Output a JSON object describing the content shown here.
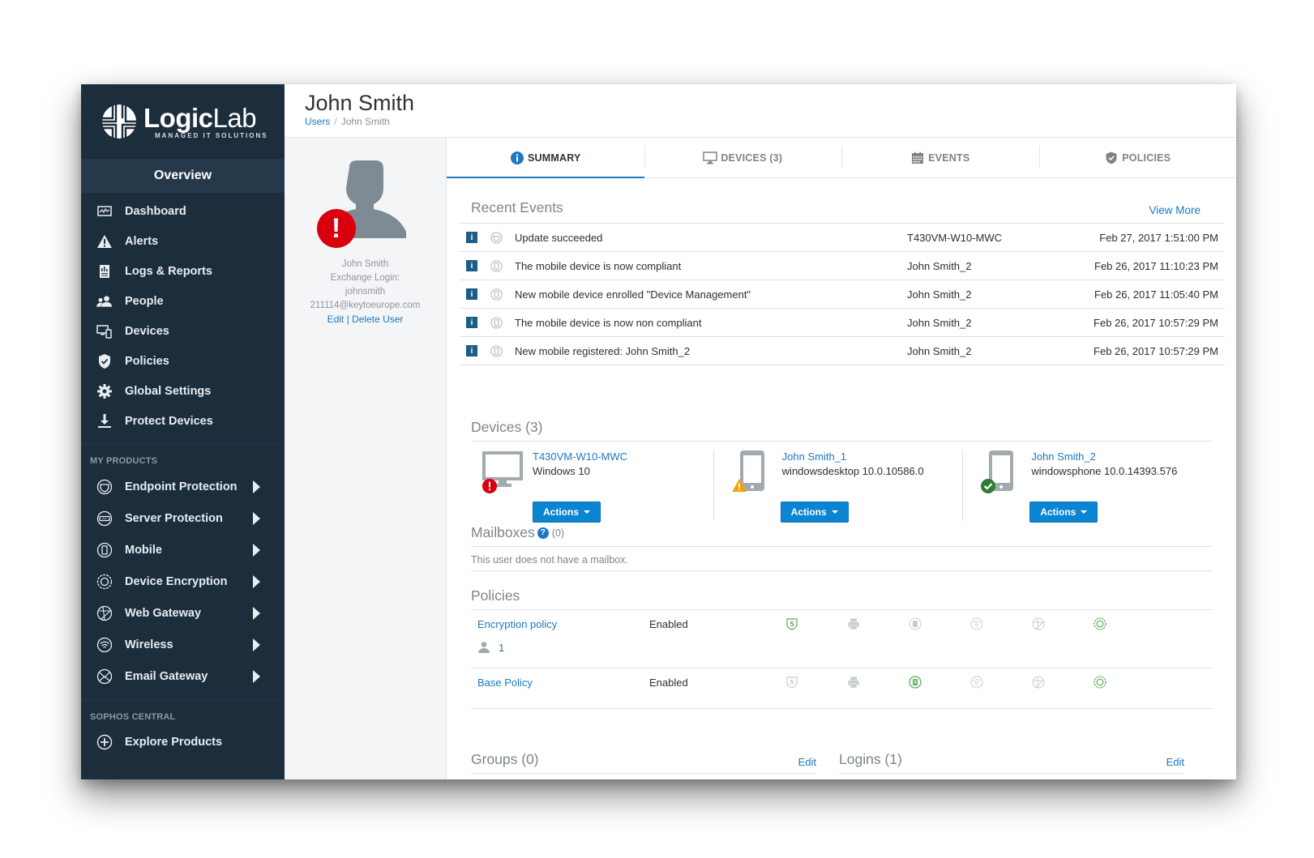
{
  "brand": {
    "name_bold": "Logic",
    "name_light": "Lab",
    "tagline": "MANAGED IT SOLUTIONS"
  },
  "sidebar": {
    "overview_label": "Overview",
    "nav": [
      {
        "label": "Dashboard",
        "icon": "dashboard-icon"
      },
      {
        "label": "Alerts",
        "icon": "alert-icon"
      },
      {
        "label": "Logs & Reports",
        "icon": "report-icon"
      },
      {
        "label": "People",
        "icon": "people-icon"
      },
      {
        "label": "Devices",
        "icon": "devices-icon"
      },
      {
        "label": "Policies",
        "icon": "shield-check-icon"
      },
      {
        "label": "Global Settings",
        "icon": "gear-icon"
      },
      {
        "label": "Protect Devices",
        "icon": "download-icon"
      }
    ],
    "products_title": "MY PRODUCTS",
    "products": [
      {
        "label": "Endpoint Protection",
        "icon": "endpoint-icon"
      },
      {
        "label": "Server Protection",
        "icon": "server-icon"
      },
      {
        "label": "Mobile",
        "icon": "mobile-icon"
      },
      {
        "label": "Device Encryption",
        "icon": "encryption-icon"
      },
      {
        "label": "Web Gateway",
        "icon": "web-icon"
      },
      {
        "label": "Wireless",
        "icon": "wireless-icon"
      },
      {
        "label": "Email Gateway",
        "icon": "email-icon"
      }
    ],
    "central_title": "SOPHOS CENTRAL",
    "central": [
      {
        "label": "Explore Products",
        "icon": "plus-circle-icon"
      }
    ]
  },
  "header": {
    "title": "John Smith",
    "breadcrumb": [
      {
        "label": "Users",
        "link": true
      },
      {
        "label": "John Smith",
        "link": false
      }
    ]
  },
  "profile": {
    "name": "John Smith",
    "exchange_label": "Exchange Login:",
    "exchange_login": "johnsmith",
    "email": "211114@keytoeurope.com",
    "edit_label": "Edit",
    "link_sep": "|",
    "delete_label": "Delete User"
  },
  "tabs": [
    {
      "label": "SUMMARY",
      "icon": "info-icon",
      "active": true
    },
    {
      "label": "DEVICES (3)",
      "icon": "monitor-icon",
      "active": false
    },
    {
      "label": "EVENTS",
      "icon": "calendar-icon",
      "active": false
    },
    {
      "label": "POLICIES",
      "icon": "shield-icon",
      "active": false
    }
  ],
  "recent_events": {
    "title": "Recent Events",
    "view_more": "View More",
    "rows": [
      {
        "type_icon": "endpoint-icon",
        "message": "Update succeeded",
        "device": "T430VM-W10-MWC",
        "time": "Feb 27, 2017 1:51:00 PM"
      },
      {
        "type_icon": "mobile-icon",
        "message": "The mobile device is now compliant",
        "device": "John Smith_2",
        "time": "Feb 26, 2017 11:10:23 PM"
      },
      {
        "type_icon": "mobile-icon",
        "message": "New mobile device enrolled \"Device Management\"",
        "device": "John Smith_2",
        "time": "Feb 26, 2017 11:05:40 PM"
      },
      {
        "type_icon": "mobile-icon",
        "message": "The mobile device is now non compliant",
        "device": "John Smith_2",
        "time": "Feb 26, 2017 10:57:29 PM"
      },
      {
        "type_icon": "mobile-icon",
        "message": "New mobile registered: John Smith_2",
        "device": "John Smith_2",
        "time": "Feb 26, 2017 10:57:29 PM"
      }
    ]
  },
  "devices": {
    "title": "Devices (3)",
    "items": [
      {
        "name": "T430VM-W10-MWC",
        "os": "Windows 10",
        "kind": "desktop",
        "status": "error",
        "actions_label": "Actions"
      },
      {
        "name": "John Smith_1",
        "os": "windowsdesktop 10.0.10586.0",
        "kind": "mobile",
        "status": "warning",
        "actions_label": "Actions"
      },
      {
        "name": "John Smith_2",
        "os": "windowsphone 10.0.14393.576",
        "kind": "mobile",
        "status": "ok",
        "actions_label": "Actions"
      }
    ]
  },
  "mailboxes": {
    "title": "Mailboxes",
    "help": "?",
    "count": "(0)",
    "note": "This user does not have a mailbox."
  },
  "policies": {
    "title": "Policies",
    "product_icons": [
      "encryption-shield-icon",
      "printer-icon",
      "mobile-icon",
      "wireless-icon",
      "web-icon",
      "endpoint-gear-icon"
    ],
    "rows": [
      {
        "name": "Encryption policy",
        "status": "Enabled",
        "users": "1",
        "icon_states": [
          true,
          false,
          false,
          false,
          false,
          true
        ]
      },
      {
        "name": "Base Policy",
        "status": "Enabled",
        "users": null,
        "icon_states": [
          false,
          false,
          true,
          false,
          false,
          true
        ]
      }
    ]
  },
  "groups": {
    "title": "Groups (0)",
    "edit_label": "Edit"
  },
  "logins": {
    "title": "Logins (1)",
    "edit_label": "Edit"
  },
  "colors": {
    "sidebar_bg": "#1c2d3c",
    "accent_blue": "#1b78c4",
    "button_blue": "#0b85d1",
    "error_red": "#d9000d",
    "warning_orange": "#f0a30a",
    "ok_green": "#2e7d32",
    "policy_on_green": "#5cae5c",
    "policy_off_gray": "#c9cdd1"
  }
}
